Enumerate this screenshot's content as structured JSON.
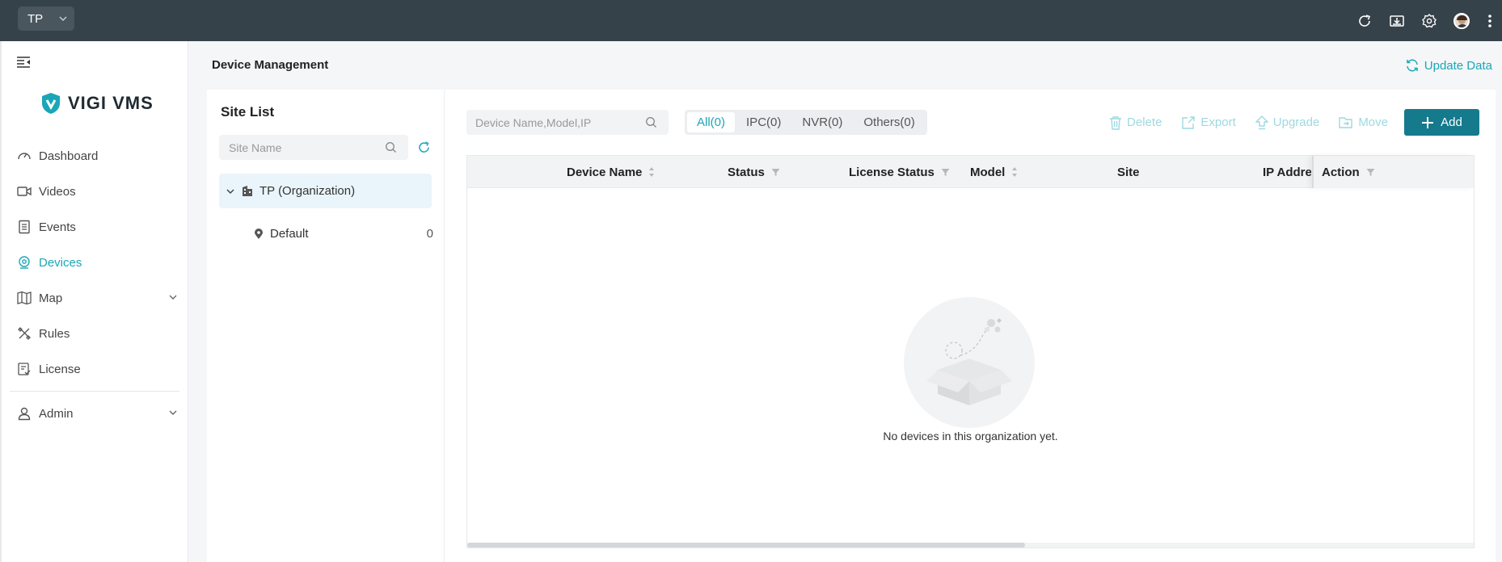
{
  "topbar": {
    "org_selector": "TP",
    "icons": [
      "refresh-icon",
      "download-icon",
      "settings-icon",
      "user-avatar",
      "more-vertical-icon"
    ]
  },
  "sidebar": {
    "logo": "VIGI VMS",
    "items": [
      {
        "label": "Dashboard",
        "icon": "dashboard-icon"
      },
      {
        "label": "Videos",
        "icon": "video-camera-icon"
      },
      {
        "label": "Events",
        "icon": "events-list-icon"
      },
      {
        "label": "Devices",
        "icon": "webcam-icon",
        "active": true
      },
      {
        "label": "Map",
        "icon": "map-icon",
        "expandable": true
      },
      {
        "label": "Rules",
        "icon": "rules-tools-icon"
      },
      {
        "label": "License",
        "icon": "license-icon"
      },
      {
        "label": "Admin",
        "icon": "admin-user-icon",
        "expandable": true
      }
    ]
  },
  "header": {
    "title": "Device Management",
    "update_label": "Update Data"
  },
  "site_list": {
    "title": "Site List",
    "search_placeholder": "Site Name",
    "org_node": "TP (Organization)",
    "sites": [
      {
        "name": "Default",
        "count": "0"
      }
    ]
  },
  "devices": {
    "search_placeholder": "Device Name,Model,IP",
    "tabs": [
      "All(0)",
      "IPC(0)",
      "NVR(0)",
      "Others(0)"
    ],
    "active_tab": "All(0)",
    "actions": {
      "delete": "Delete",
      "export": "Export",
      "upgrade": "Upgrade",
      "move": "Move",
      "add": "Add"
    },
    "columns": {
      "name": "Device Name",
      "status": "Status",
      "license": "License Status",
      "model": "Model",
      "site": "Site",
      "ip": "IP Addres",
      "action": "Action"
    },
    "empty_text": "No devices in this organization yet."
  },
  "colors": {
    "topbar": "#36424a",
    "accent": "#1aa6b7",
    "primary_button": "#157a8c",
    "disabled_action": "#9ed9e1"
  }
}
